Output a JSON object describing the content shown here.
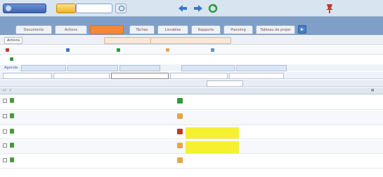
{
  "topbar": {
    "app_label": "",
    "search_label": "",
    "search_value": "",
    "nav_icons": [
      "back-arrow-icon",
      "forward-arrow-icon",
      "refresh-icon"
    ],
    "tool_icon": "pin-icon"
  },
  "tabs": [
    {
      "label": "Documents",
      "active": false
    },
    {
      "label": "Actions",
      "active": false
    },
    {
      "label": "",
      "active": true
    },
    {
      "label": "Tâches",
      "active": false
    },
    {
      "label": "Livrables",
      "active": false
    },
    {
      "label": "Rapports",
      "active": false
    },
    {
      "label": "Planning",
      "active": false
    },
    {
      "label": "Tableau de projet",
      "active": false
    }
  ],
  "breadcrumb": {
    "first": "Actions",
    "second": "",
    "third": "",
    "fourth": ""
  },
  "toolbar": {
    "item1": "",
    "item2": "",
    "item3": "",
    "item4": "",
    "item5": "",
    "export": ""
  },
  "filters": {
    "row1": [
      "Agenda",
      "",
      "",
      "",
      "",
      ""
    ],
    "row2": [
      "",
      "",
      "",
      "",
      "",
      ""
    ]
  },
  "grid": {
    "headers": [
      "",
      "",
      "",
      "",
      "",
      "",
      "",
      ""
    ],
    "rows": [
      {
        "title": "",
        "person": "",
        "date": "",
        "status_color": "#2b9c3a",
        "decision": "",
        "note": "",
        "highlight": false
      },
      {
        "title": "",
        "person": "",
        "date": "",
        "status_color": "#e8a44a",
        "decision": "",
        "note": "",
        "highlight": false
      },
      {
        "title": "",
        "person": "",
        "date": "",
        "status_color": "#c0392b",
        "decision": "",
        "note": "",
        "highlight": true
      },
      {
        "title": "",
        "person": "",
        "date": "",
        "status_color": "#e8a44a",
        "decision": "",
        "note": "",
        "highlight": true
      },
      {
        "title": "",
        "person": "",
        "date": "",
        "status_color": "#e8a44a",
        "decision": "",
        "note": "",
        "highlight": false
      }
    ]
  },
  "colors": {
    "accent": "#f08a3a",
    "highlight": "#f5f030",
    "link": "#c0392b",
    "tabbar": "#7f9fc8"
  }
}
